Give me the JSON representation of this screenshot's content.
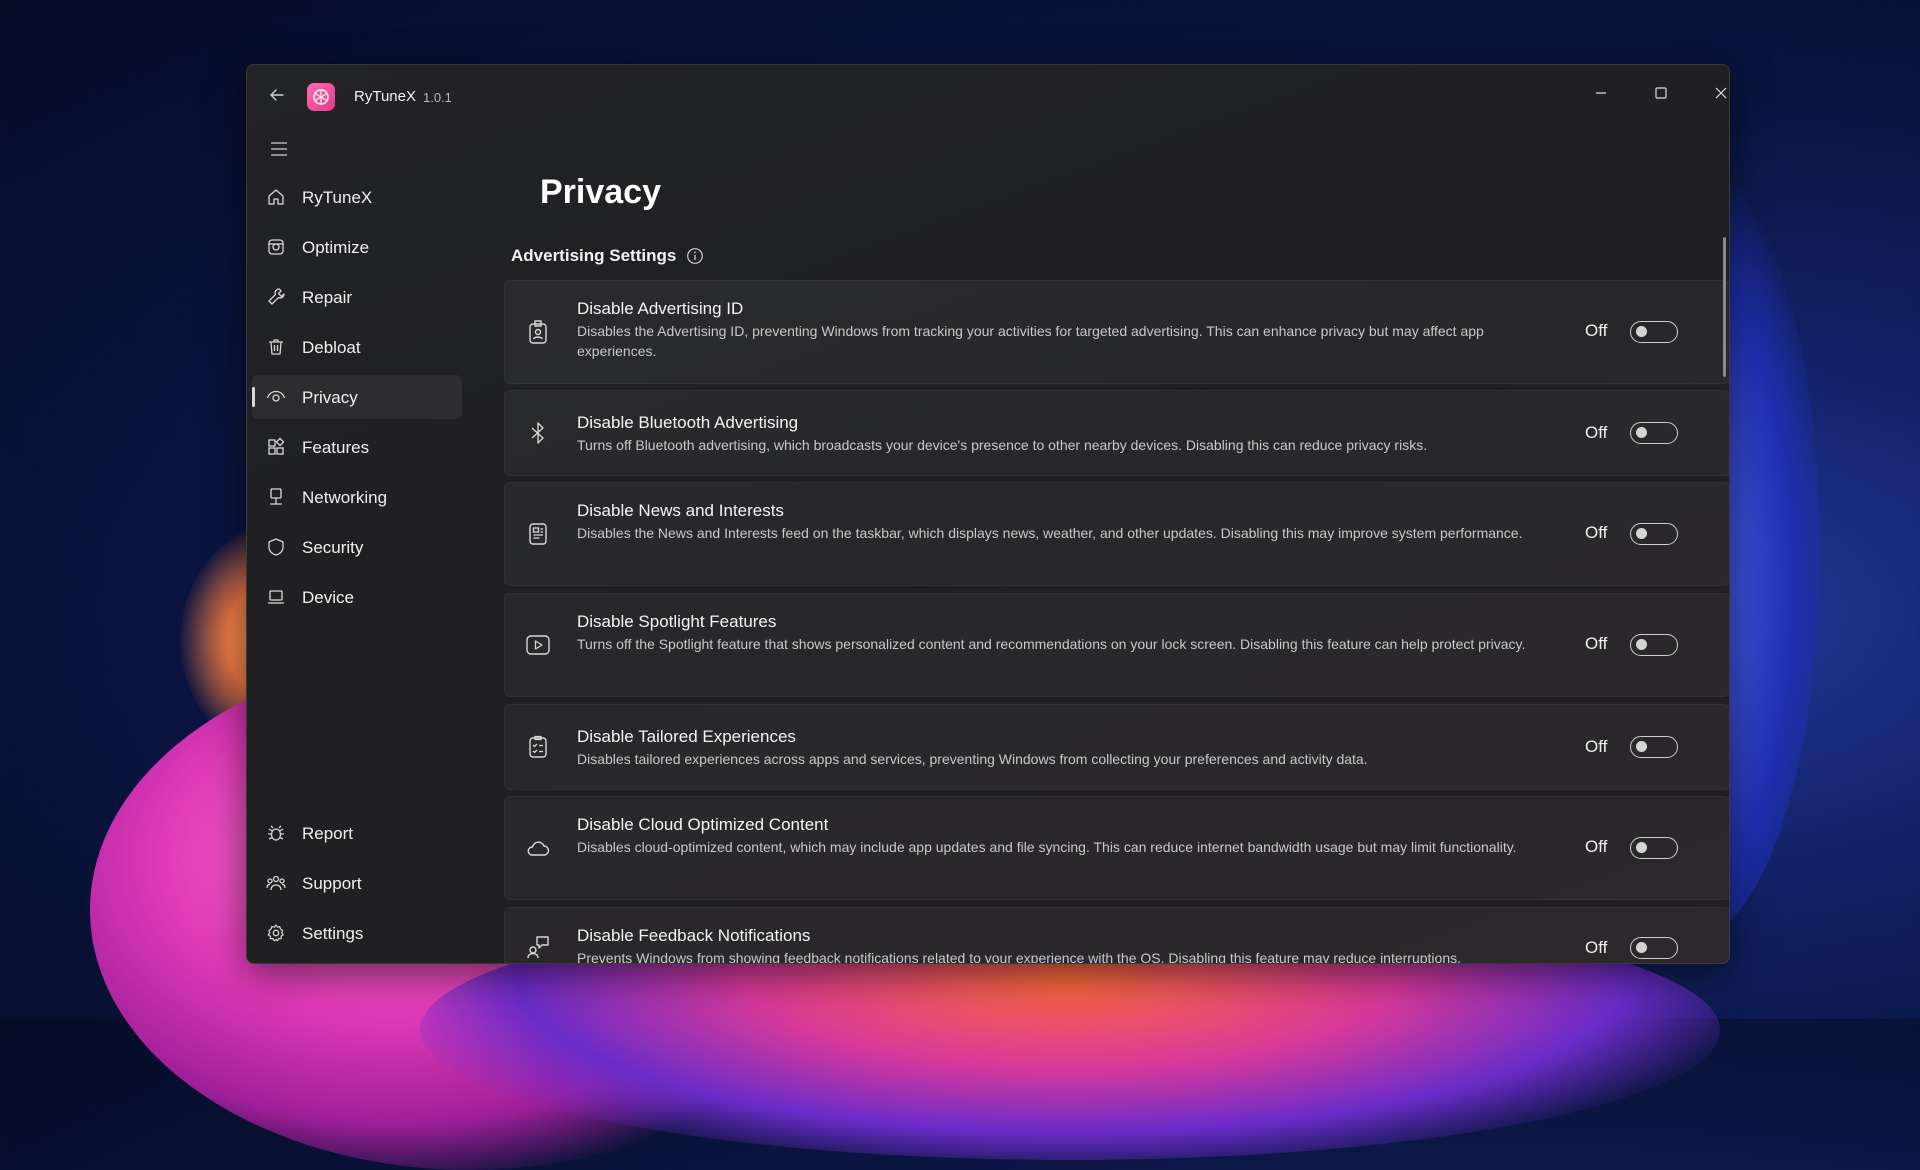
{
  "app": {
    "name": "RyTuneX",
    "version": "1.0.1"
  },
  "nav": {
    "items": [
      {
        "label": "RyTuneX",
        "icon": "home-icon"
      },
      {
        "label": "Optimize",
        "icon": "optimize-icon"
      },
      {
        "label": "Repair",
        "icon": "wrench-icon"
      },
      {
        "label": "Debloat",
        "icon": "trash-icon"
      },
      {
        "label": "Privacy",
        "icon": "eye-icon",
        "selected": true
      },
      {
        "label": "Features",
        "icon": "grid-icon"
      },
      {
        "label": "Networking",
        "icon": "network-icon"
      },
      {
        "label": "Security",
        "icon": "shield-icon"
      },
      {
        "label": "Device",
        "icon": "laptop-icon"
      }
    ],
    "footer": [
      {
        "label": "Report",
        "icon": "bug-icon"
      },
      {
        "label": "Support",
        "icon": "people-icon"
      },
      {
        "label": "Settings",
        "icon": "gear-icon"
      }
    ]
  },
  "page": {
    "title": "Privacy"
  },
  "section": {
    "title": "Advertising Settings"
  },
  "settings": [
    {
      "title": "Disable Advertising ID",
      "description": "Disables the Advertising ID, preventing Windows from tracking your activities for targeted advertising. This can enhance privacy but may affect app experiences.",
      "state": "Off",
      "icon": "id-badge-icon"
    },
    {
      "title": "Disable Bluetooth Advertising",
      "description": "Turns off Bluetooth advertising, which broadcasts your device's presence to other nearby devices. Disabling this can reduce privacy risks.",
      "state": "Off",
      "icon": "bluetooth-icon"
    },
    {
      "title": "Disable News and Interests",
      "description": "Disables the News and Interests feed on the taskbar, which displays news, weather, and other updates. Disabling this may improve system performance.",
      "state": "Off",
      "icon": "news-icon"
    },
    {
      "title": "Disable Spotlight Features",
      "description": "Turns off the Spotlight feature that shows personalized content and recommendations on your lock screen. Disabling this feature can help protect privacy.",
      "state": "Off",
      "icon": "play-icon"
    },
    {
      "title": "Disable Tailored Experiences",
      "description": "Disables tailored experiences across apps and services, preventing Windows from collecting your preferences and activity data.",
      "state": "Off",
      "icon": "clipboard-check-icon"
    },
    {
      "title": "Disable Cloud Optimized Content",
      "description": "Disables cloud-optimized content, which may include app updates and file syncing. This can reduce internet bandwidth usage but may limit functionality.",
      "state": "Off",
      "icon": "cloud-icon"
    },
    {
      "title": "Disable Feedback Notifications",
      "description": "Prevents Windows from showing feedback notifications related to your experience with the OS. Disabling this feature may reduce interruptions.",
      "state": "Off",
      "icon": "feedback-icon"
    }
  ]
}
